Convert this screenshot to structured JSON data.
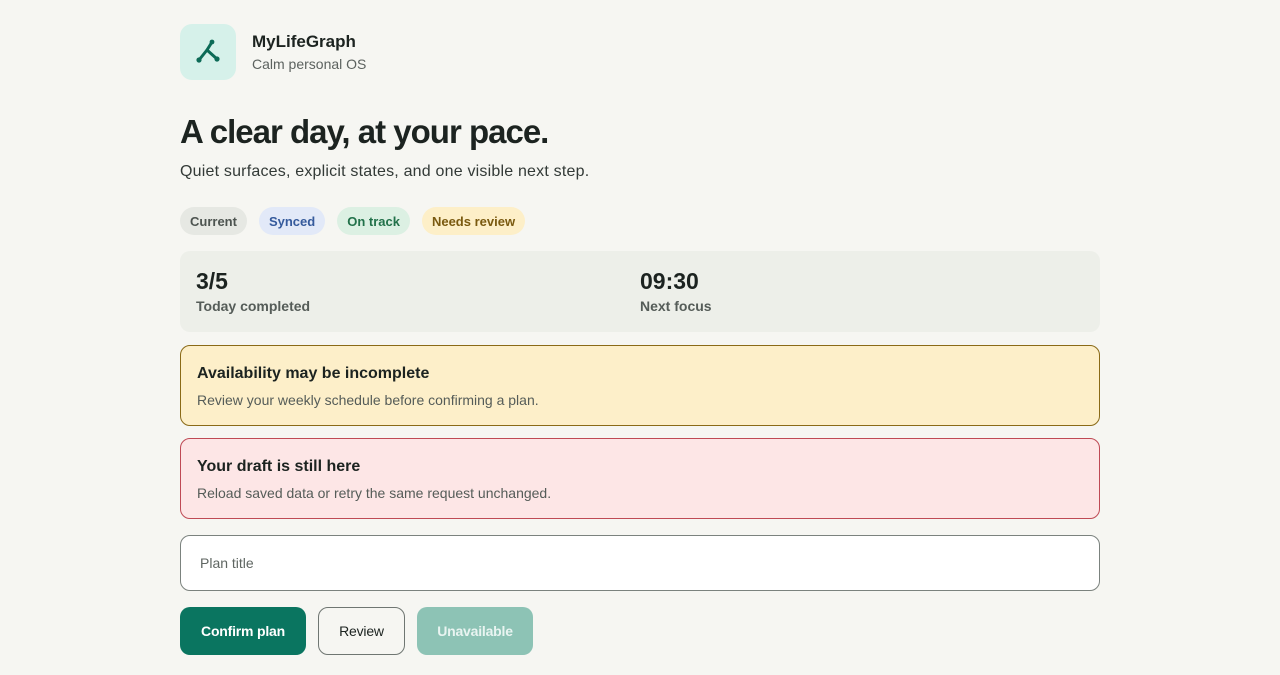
{
  "brand": {
    "name": "MyLifeGraph",
    "subtitle": "Calm personal OS",
    "logo_icon": "graph-line-icon",
    "accent": "#0a7560"
  },
  "hero": {
    "headline": "A clear day, at your pace.",
    "lede": "Quiet surfaces, explicit states, and one visible next step."
  },
  "chips": [
    {
      "label": "Current",
      "color": "#4d5450"
    },
    {
      "label": "Synced",
      "color": "#355a9c"
    },
    {
      "label": "On track",
      "color": "#22714a"
    },
    {
      "label": "Needs review",
      "color": "#7a5a10"
    }
  ],
  "stats": [
    {
      "value": "3/5",
      "label": "Today completed"
    },
    {
      "value": "09:30",
      "label": "Next focus"
    }
  ],
  "alerts": {
    "warning": {
      "title": "Availability may be incomplete",
      "body": "Review your weekly schedule before confirming a plan."
    },
    "error": {
      "title": "Your draft is still here",
      "body": "Reload saved data or retry the same request unchanged."
    }
  },
  "form": {
    "plan_title_value": "",
    "plan_title_placeholder": "Plan title"
  },
  "actions": {
    "confirm_label": "Confirm plan",
    "review_label": "Review",
    "unavailable_label": "Unavailable"
  }
}
